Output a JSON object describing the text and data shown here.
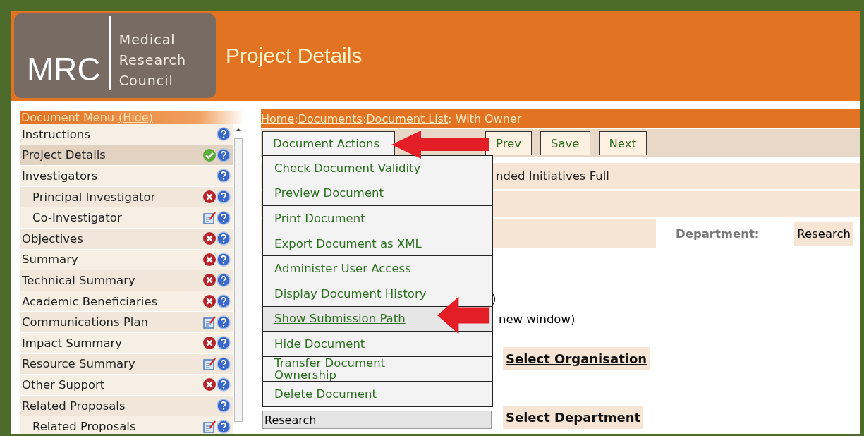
{
  "header": {
    "logo": {
      "acronym": "MRC",
      "lines": [
        "Medical",
        "Research",
        "Council"
      ]
    },
    "title": "Project Details"
  },
  "sidebar": {
    "title": "Document Menu",
    "hide_link": "(Hide)",
    "items": [
      {
        "label": "Instructions",
        "kind": "plain",
        "selected": false
      },
      {
        "label": "Project Details",
        "kind": "complete",
        "selected": true
      },
      {
        "label": "Investigators",
        "kind": "plain",
        "selected": false,
        "children": [
          {
            "label": "Principal Investigator",
            "kind": "error",
            "selected": false
          },
          {
            "label": "Co-Investigator",
            "kind": "edit",
            "selected": false
          }
        ]
      },
      {
        "label": "Objectives",
        "kind": "error",
        "selected": false
      },
      {
        "label": "Summary",
        "kind": "error",
        "selected": false
      },
      {
        "label": "Technical Summary",
        "kind": "error",
        "selected": false
      },
      {
        "label": "Academic Beneficiaries",
        "kind": "error",
        "selected": false
      },
      {
        "label": "Communications Plan",
        "kind": "edit",
        "selected": false
      },
      {
        "label": "Impact Summary",
        "kind": "error",
        "selected": false
      },
      {
        "label": "Resource Summary",
        "kind": "edit",
        "selected": false
      },
      {
        "label": "Other Support",
        "kind": "error",
        "selected": false
      },
      {
        "label": "Related Proposals",
        "kind": "plain",
        "selected": false,
        "children": [
          {
            "label": "Related Proposals",
            "kind": "edit",
            "selected": false
          }
        ]
      }
    ]
  },
  "breadcrumb": [
    {
      "label": "Home",
      "kind": "link"
    },
    {
      "label": ":",
      "kind": "text"
    },
    {
      "label": "Documents",
      "kind": "link"
    },
    {
      "label": ":",
      "kind": "text"
    },
    {
      "label": "Document List",
      "kind": "link"
    },
    {
      "label": ": With Owner",
      "kind": "text"
    }
  ],
  "toolbar": {
    "actions_button": "Document Actions",
    "buttons": [
      "Prev",
      "Save",
      "Next"
    ]
  },
  "actions_menu": [
    {
      "label": "Check Document Validity",
      "selected": false
    },
    {
      "label": "Preview Document",
      "selected": false
    },
    {
      "label": "Print Document",
      "selected": false
    },
    {
      "label": "Export Document as XML",
      "selected": false
    },
    {
      "label": "Administer User Access",
      "selected": false
    },
    {
      "label": "Display Document History",
      "selected": false
    },
    {
      "label": "Show Submission Path",
      "selected": true
    },
    {
      "label": "Hide Document",
      "selected": false
    },
    {
      "label": "Transfer Document Ownership",
      "selected": false
    },
    {
      "label": "Delete Document",
      "selected": false
    }
  ],
  "form": {
    "scheme_text": "nded Initiatives Full",
    "department_label": "Department:",
    "department_value": "Research",
    "fragment": ")",
    "window_note": "new window)",
    "organisation_link": "Select Organisation",
    "department_field": "Research",
    "department_link": "Select Department"
  }
}
